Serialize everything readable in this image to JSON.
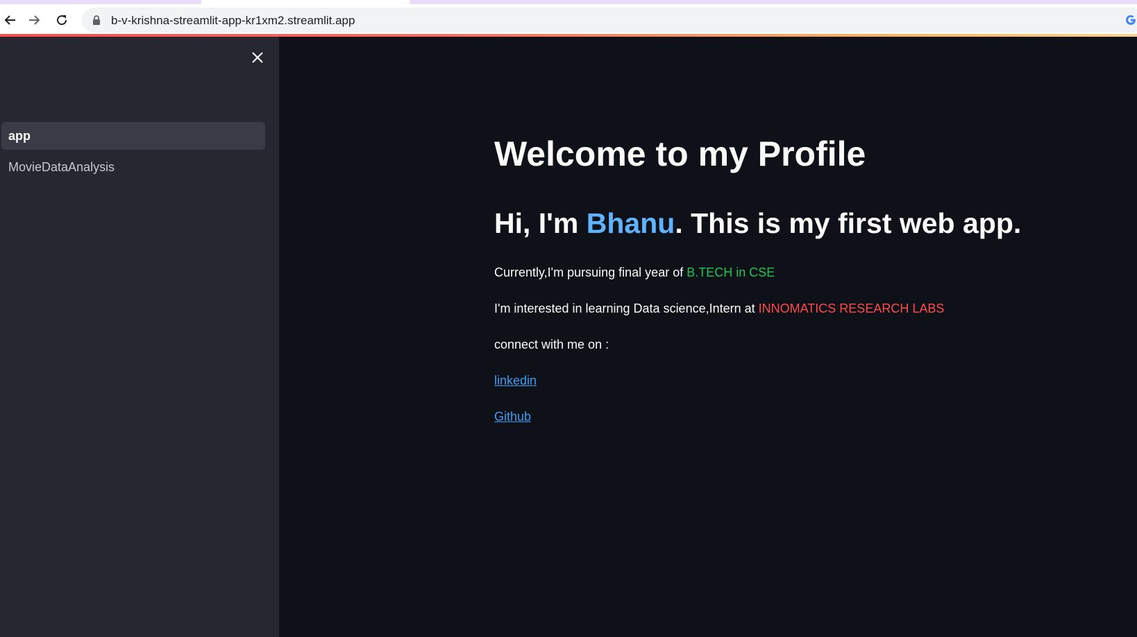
{
  "browser": {
    "url": "b-v-krishna-streamlit-app-kr1xm2.streamlit.app"
  },
  "sidebar": {
    "items": [
      {
        "label": "app",
        "active": true
      },
      {
        "label": "MovieDataAnalysis",
        "active": false
      }
    ]
  },
  "main": {
    "title": "Welcome to my Profile",
    "subtitle": {
      "prefix": "Hi, I'm ",
      "name": "Bhanu",
      "suffix": ". This is my first web app."
    },
    "line1": {
      "text": "Currently,I'm pursuing final year of ",
      "highlight": "B.TECH in CSE"
    },
    "line2": {
      "text": "I'm interested in learning Data science,Intern at ",
      "highlight": "INNOMATICS RESEARCH LABS"
    },
    "line3": {
      "text": "connect with me on :"
    },
    "links": {
      "linkedin": "linkedin",
      "github": "Github"
    }
  },
  "colors": {
    "background": "#0e1117",
    "sidebar": "#262730",
    "name_highlight": "#60b4ff",
    "green_highlight": "#21c354",
    "red_highlight": "#ff4b4b",
    "link": "#3d9df3"
  }
}
